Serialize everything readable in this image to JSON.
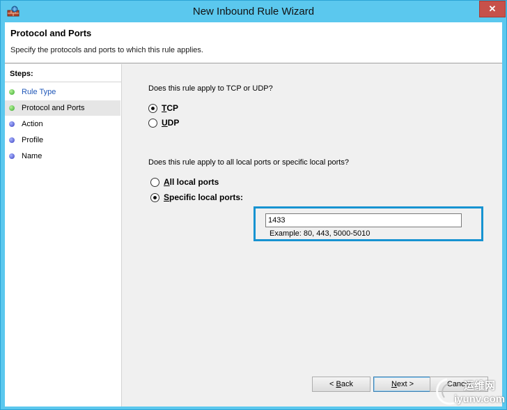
{
  "window": {
    "title": "New Inbound Rule Wizard",
    "close_glyph": "✕"
  },
  "header": {
    "title": "Protocol and Ports",
    "description": "Specify the protocols and ports to which this rule applies."
  },
  "steps": {
    "title": "Steps:",
    "items": [
      {
        "label": "Rule Type",
        "status": "completed",
        "color": "green"
      },
      {
        "label": "Protocol and Ports",
        "status": "current",
        "color": "green"
      },
      {
        "label": "Action",
        "status": "pending",
        "color": "blue"
      },
      {
        "label": "Profile",
        "status": "pending",
        "color": "blue"
      },
      {
        "label": "Name",
        "status": "pending",
        "color": "blue"
      }
    ]
  },
  "protocol": {
    "question": "Does this rule apply to TCP or UDP?",
    "options": [
      {
        "accel": "T",
        "rest": "CP",
        "checked": true
      },
      {
        "accel": "U",
        "rest": "DP",
        "checked": false
      }
    ]
  },
  "ports": {
    "question": "Does this rule apply to all local ports or specific local ports?",
    "options": [
      {
        "accel": "A",
        "rest": "ll local ports",
        "checked": false
      },
      {
        "accel": "S",
        "rest": "pecific local ports:",
        "checked": true
      }
    ],
    "value": "1433",
    "example": "Example: 80, 443, 5000-5010"
  },
  "buttons": {
    "back": {
      "prefix": "< ",
      "accel": "B",
      "rest": "ack"
    },
    "next": {
      "accel": "N",
      "rest": "ext >"
    },
    "cancel": {
      "label": "Cancel"
    }
  },
  "watermark": {
    "line1": "运维网",
    "line2": "iyunv.com"
  },
  "colors": {
    "titlebar": "#5bc8ee",
    "highlight": "#1793d1",
    "close": "#c7514a"
  }
}
